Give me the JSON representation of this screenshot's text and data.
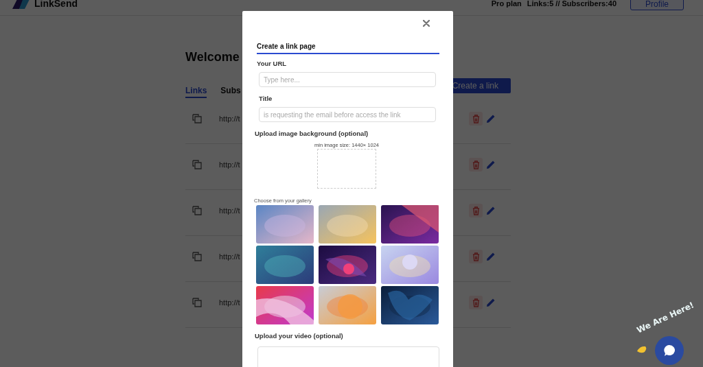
{
  "header": {
    "brand": "LinkSend",
    "plan": "Pro plan",
    "stats": "Links:5 // Subscribers:40",
    "profile_button": "Profile"
  },
  "main": {
    "heading": "Welcome",
    "create_button": "Create a link",
    "tabs": [
      {
        "label": "Links",
        "selected": true
      },
      {
        "label": "Subs",
        "selected": false
      }
    ],
    "rows": [
      {
        "url": "http://t"
      },
      {
        "url": "http://t"
      },
      {
        "url": "http://t"
      },
      {
        "url": "http://t"
      },
      {
        "url": "http://t"
      }
    ]
  },
  "modal": {
    "tab": "Create a link page",
    "url_label": "Your URL",
    "url_placeholder": "Type here...",
    "title_label": "Title",
    "title_placeholder": "is requesting the email before access the link",
    "image_label": "Upload image background (optional)",
    "image_hint": "min image size: 1440× 1024",
    "gallery_label": "Choose from your gallery",
    "video_label": "Upload your video (optional)"
  },
  "chat": {
    "caption": "We Are Here!"
  }
}
